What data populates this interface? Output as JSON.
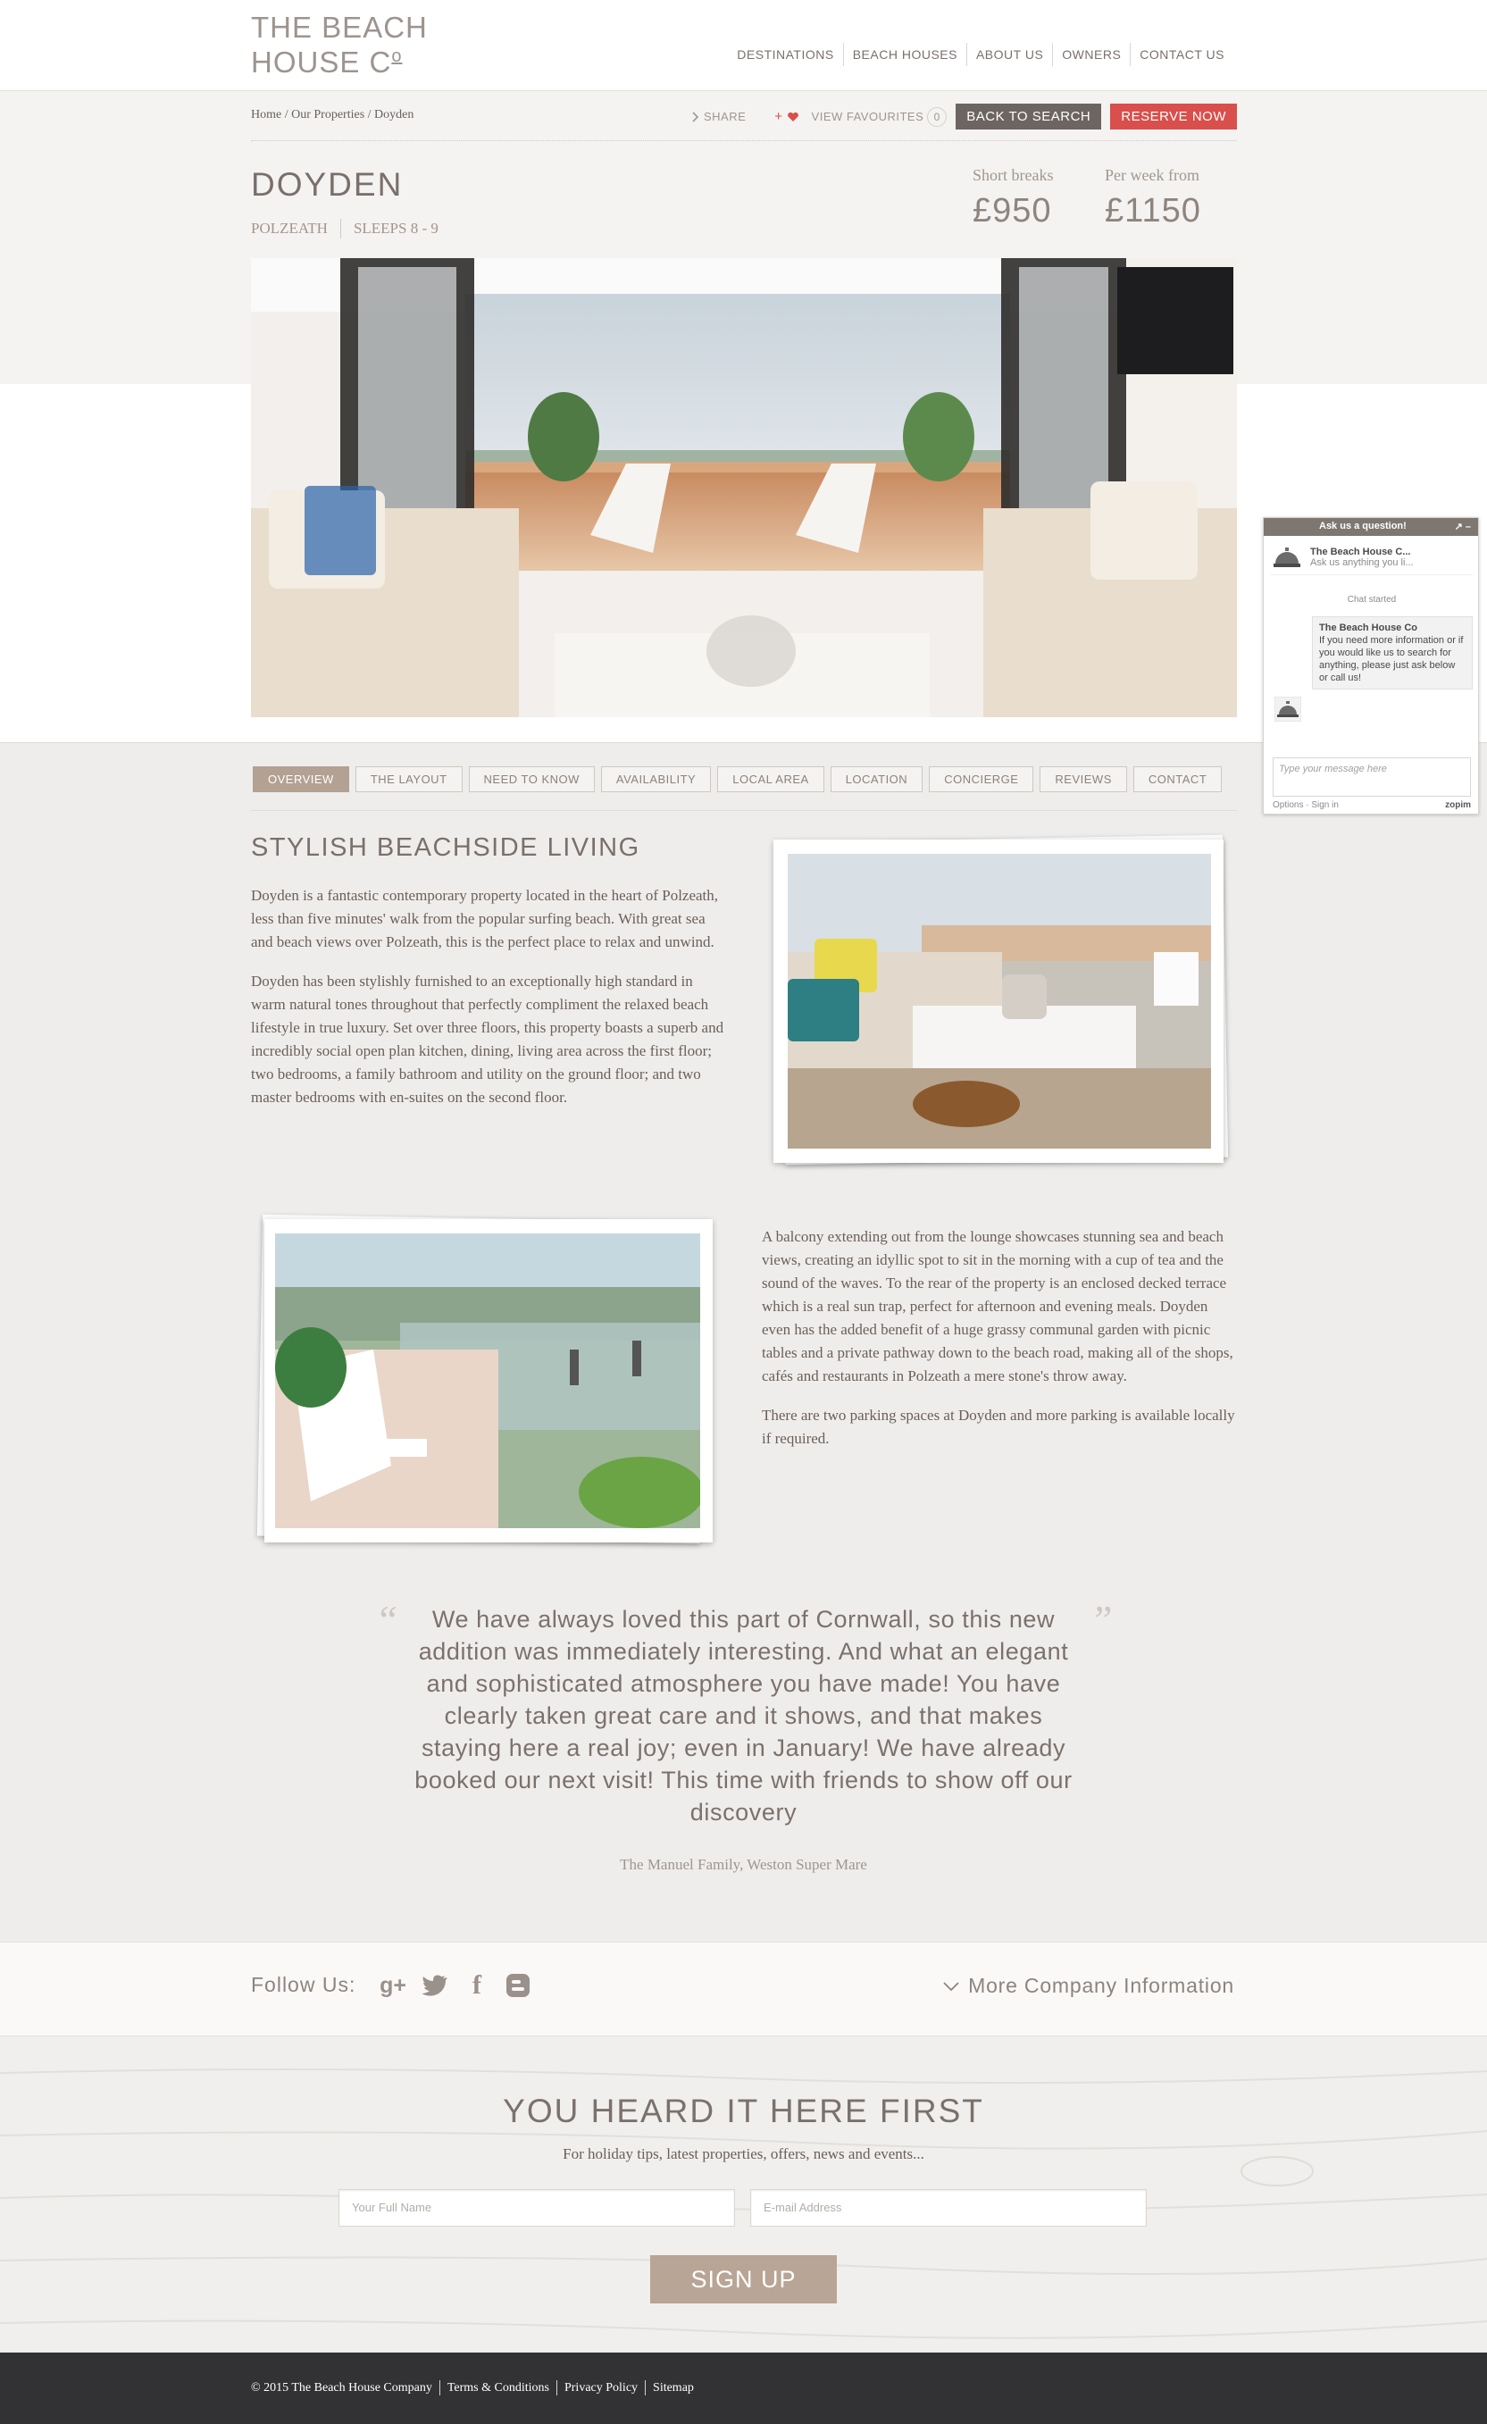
{
  "header": {
    "logo_line1": "THE BEACH",
    "logo_line2": "HOUSE C",
    "logo_super": "o",
    "nav": [
      "DESTINATIONS",
      "BEACH HOUSES",
      "ABOUT US",
      "OWNERS",
      "CONTACT US"
    ]
  },
  "breadcrumb": {
    "home": "Home",
    "sep": " / ",
    "properties": "Our Properties",
    "current": "Doyden"
  },
  "actions": {
    "share": "SHARE",
    "favourites": "VIEW FAVOURITES",
    "fav_count": "0",
    "back_to_search": "BACK TO SEARCH",
    "reserve": "RESERVE NOW"
  },
  "property": {
    "name": "DOYDEN",
    "location": "POLZEATH",
    "sleeps": "SLEEPS 8 - 9",
    "short_breaks_label": "Short breaks",
    "short_breaks_price": "£950",
    "per_week_label": "Per week from",
    "per_week_price": "£1150"
  },
  "tabs": [
    "OVERVIEW",
    "THE LAYOUT",
    "NEED TO KNOW",
    "AVAILABILITY",
    "LOCAL AREA",
    "LOCATION",
    "CONCIERGE",
    "REVIEWS",
    "CONTACT"
  ],
  "content": {
    "title": "STYLISH BEACHSIDE LIVING",
    "para1": "Doyden is a fantastic contemporary property located in the heart of Polzeath, less than five minutes' walk from the popular surfing beach. With great sea and beach views over Polzeath, this is the perfect place to relax and unwind.",
    "para2": "Doyden has been stylishly furnished to an exceptionally high standard in warm natural tones throughout that perfectly compliment the relaxed beach lifestyle in true luxury. Set over three floors, this property boasts a superb and incredibly social open plan kitchen, dining, living area across the first floor; two bedrooms, a family bathroom and utility on the ground floor; and two master bedrooms with en-suites on the second floor.",
    "para3": "A balcony extending out from the lounge showcases stunning sea and beach views, creating an idyllic spot to sit in the morning with a cup of tea and the sound of the waves. To the rear of the property is an enclosed decked terrace which is a real sun trap, perfect for afternoon and evening meals. Doyden even has the added benefit of a huge grassy communal garden with picnic tables and a private pathway down to the beach road, making all of the shops, cafés and restaurants in Polzeath a mere stone's throw away.",
    "para4": "There are two parking spaces at Doyden and more parking is available locally if required."
  },
  "testimonial": {
    "quote": "We have always loved this part of Cornwall, so this new addition was immediately interesting. And what an elegant and sophisticated atmosphere you have made! You have clearly taken great care and it shows, and that makes staying here a real joy; even in January! We have already booked our next visit! This time with friends to show off our discovery",
    "author": "The Manuel Family, Weston Super Mare"
  },
  "follow": {
    "label": "Follow Us:",
    "icons": [
      "google-plus-icon",
      "twitter-icon",
      "facebook-icon",
      "blogger-icon"
    ],
    "more": "More Company Information"
  },
  "newsletter": {
    "title": "YOU HEARD IT HERE FIRST",
    "subtitle": "For holiday tips, latest properties, offers, news and events...",
    "name_placeholder": "Your Full Name",
    "email_placeholder": "E-mail Address",
    "button": "SIGN UP"
  },
  "footer": {
    "links": [
      "© 2015 The Beach House Company",
      "Terms & Conditions",
      "Privacy Policy",
      "Sitemap"
    ]
  },
  "chat": {
    "header": "Ask us a question!",
    "controls": "↗ –",
    "agent_name": "The Beach House C...",
    "agent_sub": "Ask us anything you li...",
    "started": "Chat started",
    "bubble_name": "The Beach House Co",
    "bubble_text": "If you need more information or if you would like us to search for anything, please just ask below or call us!",
    "placeholder": "Type your message here",
    "options": "Options · Sign in",
    "brand": "zopim"
  },
  "colors": {
    "accent": "#d84f4b",
    "tab_active": "#b3a193",
    "footer_bg": "#323235",
    "signup": "#b8a595"
  }
}
